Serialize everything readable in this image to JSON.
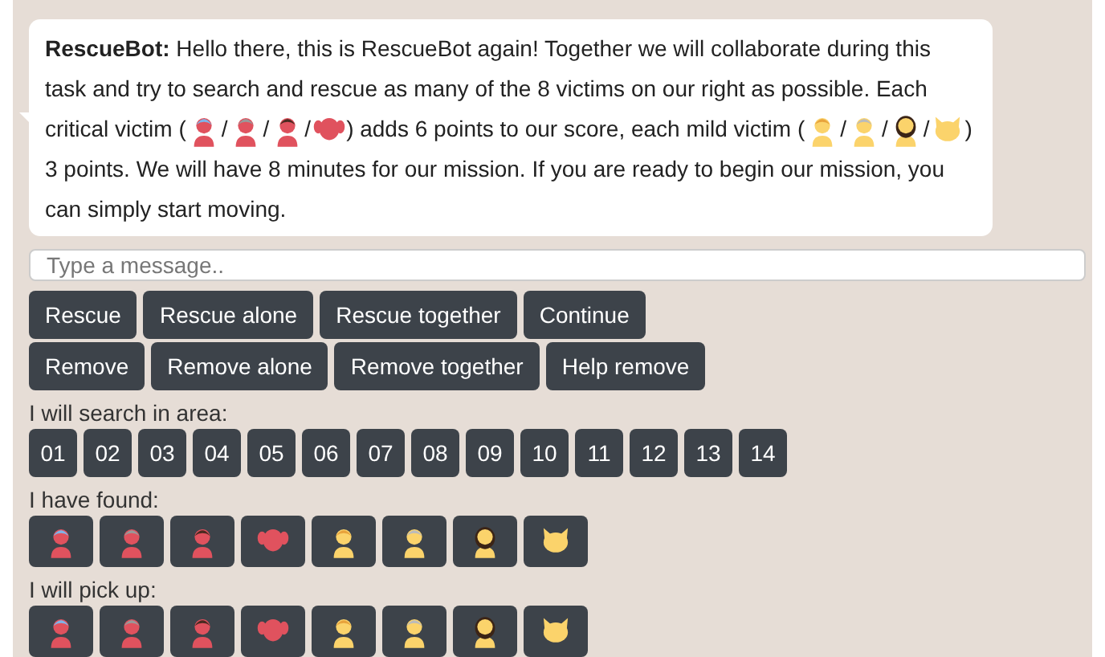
{
  "message": {
    "sender": "RescueBot:",
    "parts": [
      {
        "kind": "text",
        "text": " Hello there, this is RescueBot again! Together we will collaborate during this task and try to search and rescue as many of the 8 victims on our right as possible. Each critical victim ("
      },
      {
        "kind": "girl",
        "color": "#e0525e"
      },
      {
        "kind": "text",
        "text": "/"
      },
      {
        "kind": "old-woman",
        "color": "#e0525e"
      },
      {
        "kind": "text",
        "text": "/"
      },
      {
        "kind": "man",
        "color": "#e0525e"
      },
      {
        "kind": "text",
        "text": "/"
      },
      {
        "kind": "dog",
        "color": "#e0525e"
      },
      {
        "kind": "text",
        "text": ") adds 6 points to our score, each mild victim ("
      },
      {
        "kind": "baby",
        "color": "#fbd36b"
      },
      {
        "kind": "text",
        "text": "/"
      },
      {
        "kind": "old-man",
        "color": "#fbd36b"
      },
      {
        "kind": "text",
        "text": "/"
      },
      {
        "kind": "woman",
        "color": "#fbd36b"
      },
      {
        "kind": "text",
        "text": "/"
      },
      {
        "kind": "cat",
        "color": "#fbd36b"
      },
      {
        "kind": "text",
        "text": ") 3 points. We will have 8 minutes for our mission. If you are ready to begin our mission, you can simply start moving."
      }
    ]
  },
  "input": {
    "placeholder": "Type a message.."
  },
  "button_rows": [
    [
      "Rescue",
      "Rescue alone",
      "Rescue together",
      "Continue"
    ],
    [
      "Remove",
      "Remove alone",
      "Remove together",
      "Help remove"
    ]
  ],
  "area_label": "I will search in area:",
  "areas": [
    "01",
    "02",
    "03",
    "04",
    "05",
    "06",
    "07",
    "08",
    "09",
    "10",
    "11",
    "12",
    "13",
    "14"
  ],
  "found_label": "I have found:",
  "found": [
    {
      "kind": "girl",
      "color": "#e0525e"
    },
    {
      "kind": "old-woman",
      "color": "#e0525e"
    },
    {
      "kind": "man",
      "color": "#e0525e"
    },
    {
      "kind": "dog",
      "color": "#e0525e"
    },
    {
      "kind": "baby",
      "color": "#fbd36b"
    },
    {
      "kind": "old-man",
      "color": "#fbd36b"
    },
    {
      "kind": "woman",
      "color": "#fbd36b"
    },
    {
      "kind": "cat",
      "color": "#fbd36b"
    }
  ],
  "pickup_label": "I will pick up:",
  "pickup": [
    {
      "kind": "girl",
      "color": "#e0525e"
    },
    {
      "kind": "old-woman",
      "color": "#e0525e"
    },
    {
      "kind": "man",
      "color": "#e0525e"
    },
    {
      "kind": "dog",
      "color": "#e0525e"
    },
    {
      "kind": "baby",
      "color": "#fbd36b"
    },
    {
      "kind": "old-man",
      "color": "#fbd36b"
    },
    {
      "kind": "woman",
      "color": "#fbd36b"
    },
    {
      "kind": "cat",
      "color": "#fbd36b"
    }
  ]
}
